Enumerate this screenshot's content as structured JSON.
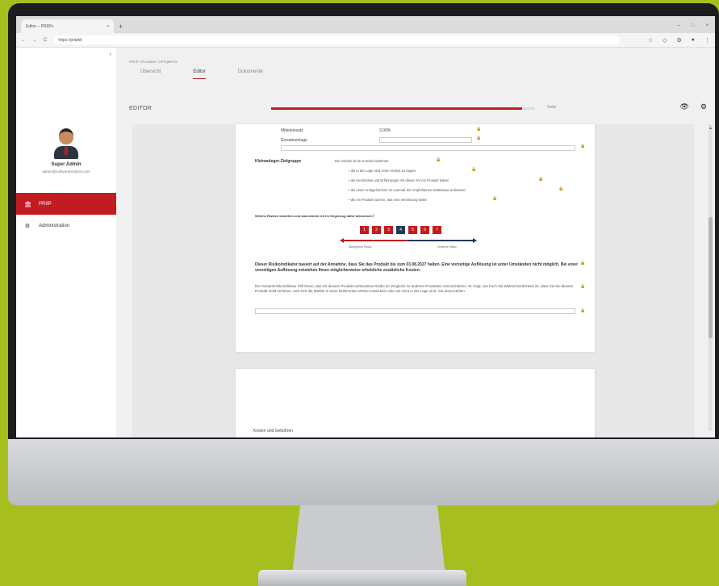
{
  "browser": {
    "tab_title": "Editor – PRIIPs",
    "tab_close": "×",
    "new_tab": "+",
    "window_controls": [
      "–",
      "□",
      "×"
    ],
    "url": "https://priipkit",
    "nav_icons": [
      "←",
      "→",
      "C"
    ],
    "right_icons": [
      "☆",
      "◇",
      "⚙",
      "●",
      "⋮"
    ]
  },
  "sidebar": {
    "collapse_icon": "‹",
    "user_name": "Super Admin",
    "user_email": "admin@softwareprojects.com",
    "items": [
      {
        "label": "PRIIP",
        "icon": "bank-icon",
        "active": true
      },
      {
        "label": "Administration",
        "icon": "gear-icon",
        "active": false
      }
    ]
  },
  "main": {
    "breadcrumb": "PRIIP / Produkte / eProjekt-01",
    "tabs": [
      "Übersicht",
      "Editor",
      "Dokumente"
    ],
    "active_tab": "Editor",
    "editor_title": "EDITOR",
    "progress_fraction": 0.95,
    "progress_label": "Seite",
    "top_icons": [
      "eye-icon",
      "gear-icon"
    ]
  },
  "doc": {
    "field1_label": "Mitteleinsatz",
    "field1_value": "3,00%",
    "field2_label": "Einsatzumlage",
    "group_label": "Kleinanleger-Zielgruppe",
    "group_intro": "Die Anleihe ist für Kunden bestimmt",
    "bullets": [
      "die in der Lage sind einen Verlust zu tragen",
      "die Kenntnisse und Erfahrungen mit dieser Art von Produkt haben",
      "die einen Anlagehorizont im Ausmaß der empfohlenen Haltedauer aufweisen",
      "die ein Produkt suchen, das eine Verzinsung bietet"
    ],
    "risk_question": "Welche Risiken bestehen und was könnte ich im Gegenzug dafür bekommen?",
    "risk_boxes": [
      "1",
      "2",
      "3",
      "4",
      "5",
      "6",
      "7"
    ],
    "risk_selected": "4",
    "risk_low_label": "Niedrigeres Risiko",
    "risk_high_label": "Höheres Risiko",
    "para_bold": "Dieser Risikoindikator basiert auf der Annahme, dass Sie das Produkt bis zum 03.08.2027 halten. Eine vorzeitige Auflösung ist unter Umständen nicht möglich. Bei einer vorzeitigen Auflösung entstehen Ihnen möglicherweise erhebliche zusätzliche Kosten.",
    "para_text": "Der Gesamtrisikoindikator hilft Ihnen, das mit diesem Produkt verbundene Risiko im Vergleich zu anderen Produkten einzuschätzen. Er zeigt, wie hoch die Wahrscheinlichkeit ist, dass Sie bei diesem Produkt Geld verlieren, weil sich die Märkte in einer bestimmten Weise entwickeln oder wir nicht in der Lage sind, Sie auszuzahlen.",
    "lock_icon": "🔒",
    "next_page_caption": "Kosten und Gebühren"
  }
}
